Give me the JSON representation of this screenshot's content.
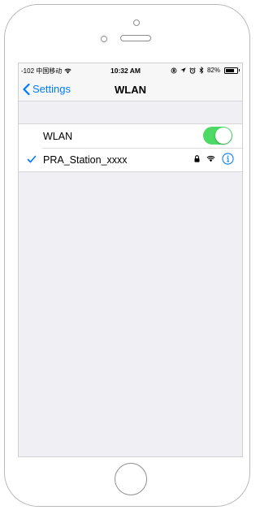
{
  "status_bar": {
    "carrier": "-102 中国移动",
    "time": "10:32 AM",
    "battery_text": "82%",
    "battery_level": 0.82
  },
  "nav": {
    "back_label": "Settings",
    "title": "WLAN"
  },
  "wlan": {
    "toggle_label": "WLAN",
    "enabled": true,
    "network_name": "PRA_Station_xxxx",
    "network_connected": true,
    "network_secured": true
  },
  "colors": {
    "accent": "#007aff",
    "toggle_on": "#4cd964",
    "background": "#efeff4"
  }
}
